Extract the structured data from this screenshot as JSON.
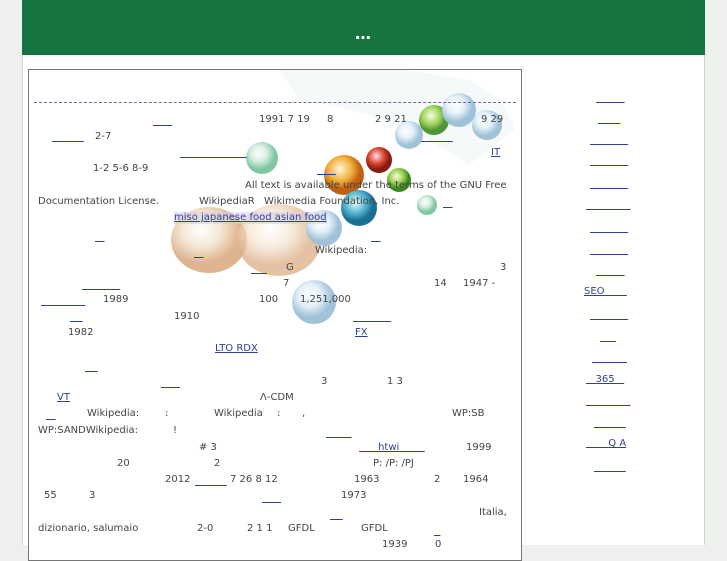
{
  "header": {
    "title": "…"
  },
  "content": {
    "snippets": [
      "1991 7 19",
      "8",
      "2 9 21",
      "9 29",
      "2-7",
      "IT",
      "1-2   5-6   8-9",
      "All text is available under the terms of the GNU Free",
      "Documentation License.",
      "WikipediaR",
      "Wikimedia Foundation, Inc.",
      "miso japanese food asian food",
      "Wikipedia:",
      "G",
      "3",
      "7",
      "14",
      "1947 -",
      "1989",
      "100",
      "1,251,000",
      "1910",
      "1982",
      "FX",
      "LTO RDX",
      "3",
      "1   3",
      "VT",
      "Λ-CDM",
      "Wikipedia:",
      ":",
      "Wikipedia",
      ":",
      ",",
      "WP:SB",
      "WP:SANDWikipedia:",
      "!",
      "# 3",
      "htwi",
      "1999",
      "20",
      "2",
      "P:  /P:  /PJ",
      "2012",
      "7 26   8 12",
      "1963",
      "2",
      "1964",
      "55",
      "3",
      "1973",
      "Italia,",
      "dizionario, salumaio",
      "2-0",
      "2 1   1",
      "GFDL",
      "GFDL",
      "1939",
      "0"
    ]
  },
  "sidebar": {
    "links": [
      "",
      "",
      "",
      "",
      "",
      "",
      "",
      "",
      "",
      "SEO",
      "",
      "",
      "",
      "365",
      "",
      "",
      "Q A",
      ""
    ]
  }
}
